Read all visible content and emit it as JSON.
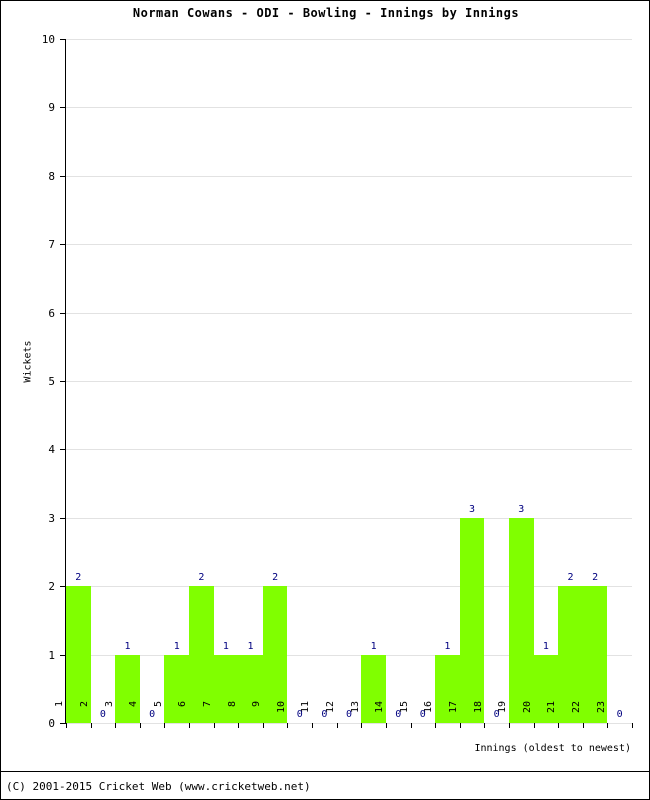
{
  "chart_data": {
    "type": "bar",
    "title": "Norman Cowans - ODI - Bowling - Innings by Innings",
    "xlabel": "Innings (oldest to newest)",
    "ylabel": "Wickets",
    "categories": [
      "1",
      "2",
      "3",
      "4",
      "5",
      "6",
      "7",
      "8",
      "9",
      "10",
      "11",
      "12",
      "13",
      "14",
      "15",
      "16",
      "17",
      "18",
      "19",
      "20",
      "21",
      "22",
      "23"
    ],
    "values": [
      2,
      0,
      1,
      0,
      1,
      2,
      1,
      1,
      2,
      0,
      0,
      0,
      1,
      0,
      0,
      1,
      3,
      0,
      3,
      1,
      2,
      2,
      0
    ],
    "data_labels": [
      "2",
      "0",
      "1",
      "0",
      "1",
      "2",
      "1",
      "1",
      "2",
      "0",
      "0",
      "0",
      "1",
      "0",
      "0",
      "1",
      "3",
      "0",
      "3",
      "1",
      "2",
      "2",
      "0"
    ],
    "ylim": [
      0,
      10
    ],
    "ytick_labels": [
      "0",
      "1",
      "2",
      "3",
      "4",
      "5",
      "6",
      "7",
      "8",
      "9",
      "10"
    ],
    "grid": true,
    "legend": "none",
    "bar_color": "#80FF00",
    "label_color": "#000080",
    "grid_color": "#E2E2E2",
    "axis_color": "#000000"
  },
  "footer": {
    "copyright": "(C) 2001-2015 Cricket Web (www.cricketweb.net)"
  }
}
